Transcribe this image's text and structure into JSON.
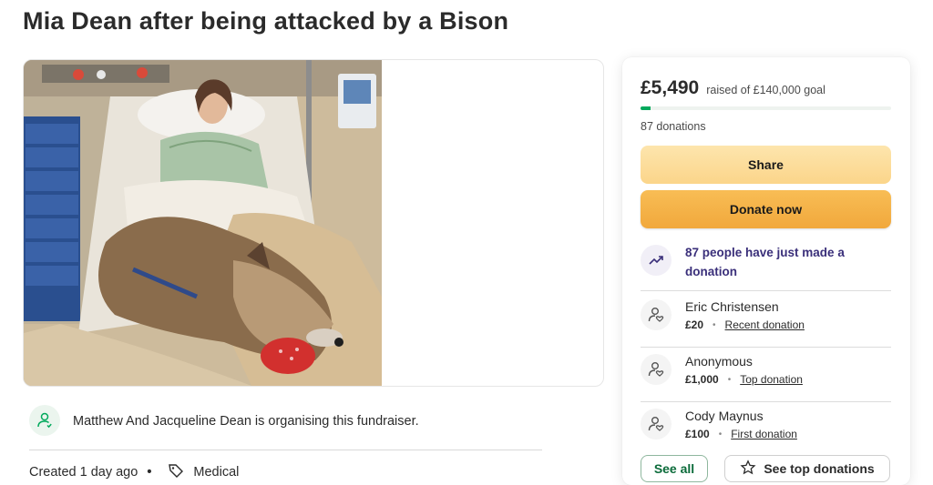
{
  "page": {
    "title": "Mia Dean after being attacked by a Bison"
  },
  "media": {
    "photo_icon": "campaign-photo"
  },
  "organiser": {
    "icon": "user-heart-icon",
    "text": "Matthew And Jacqueline Dean is organising this fundraiser."
  },
  "meta": {
    "created": "Created 1 day ago",
    "separator": "•",
    "category_icon": "tag-icon",
    "category": "Medical"
  },
  "sidebar": {
    "amount_raised": "£5,490",
    "goal_text": "raised of £140,000 goal",
    "progress_fraction": 0.039,
    "donations_count": "87 donations",
    "share_label": "Share",
    "donate_label": "Donate now",
    "trend_icon": "trending-up-icon",
    "trend_text": "87 people have just made a donation",
    "donors": [
      {
        "name": "Eric Christensen",
        "amount": "£20",
        "tag": "Recent donation"
      },
      {
        "name": "Anonymous",
        "amount": "£1,000",
        "tag": "Top donation"
      },
      {
        "name": "Cody Maynus",
        "amount": "£100",
        "tag": "First donation"
      }
    ],
    "donor_separator": "•",
    "see_all_label": "See all",
    "see_top_label": "See top donations",
    "see_top_icon": "star-icon"
  },
  "colors": {
    "brand_green": "#02a95c",
    "donate_orange": "#f1a83c",
    "share_yellow": "#fbd58a",
    "trend_purple": "#3a2f7a"
  }
}
